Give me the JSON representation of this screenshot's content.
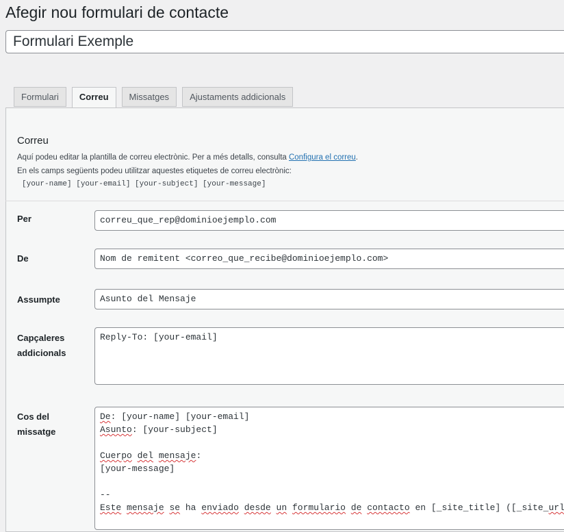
{
  "page_title": "Afegir nou formulari de contacte",
  "form_title": "Formulari Exemple",
  "tabs": [
    "Formulari",
    "Correu",
    "Missatges",
    "Ajustaments addicionals"
  ],
  "active_tab": "Correu",
  "mail": {
    "heading": "Correu",
    "desc1_pre": "Aquí podeu editar la plantilla de correu electrònic. Per a més detalls, consulta ",
    "desc1_link": "Configura el correu",
    "desc1_post": ".",
    "desc2": "En els camps següents podeu utilitzar aquestes etiquetes de correu electrònic:",
    "tags": "[your-name] [your-email] [your-subject] [your-message]",
    "to_label": "Per",
    "to_value": "correu_que_rep@dominioejemplo.com",
    "from_label": "De",
    "from_value": "Nom de remitent <correo_que_recibe@dominioejemplo.com>",
    "subject_label": "Assumpte",
    "subject_value": "Asunto del Mensaje",
    "headers_label_1": "Capçaleres",
    "headers_label_2": "addicionals",
    "headers_value": "Reply-To: [your-email]",
    "body_label_1": "Cos del",
    "body_label_2": "missatge",
    "body": {
      "l1_a": "De",
      "l1_b": ": [your-name] [your-email]",
      "l2_a": "Asunto",
      "l2_b": ": [your-subject]",
      "l3_w1": "Cuerpo",
      "l3_w2": "del",
      "l3_w3": "mensaje",
      "l3_end": ":",
      "l4": "[your-message]",
      "l5": "--",
      "l6_w1": "Este",
      "l6_w2": "mensaje",
      "l6_w3": "se",
      "l6_w4": "ha",
      "l6_w5": "enviado",
      "l6_w6": "desde",
      "l6_w7": "un",
      "l6_w8": "formulario",
      "l6_w9": "de",
      "l6_w10": "contacto",
      "l6_w11": "en [_site_title] ([_site_",
      "l6_w12": "url",
      "l6_w13": "])"
    }
  }
}
